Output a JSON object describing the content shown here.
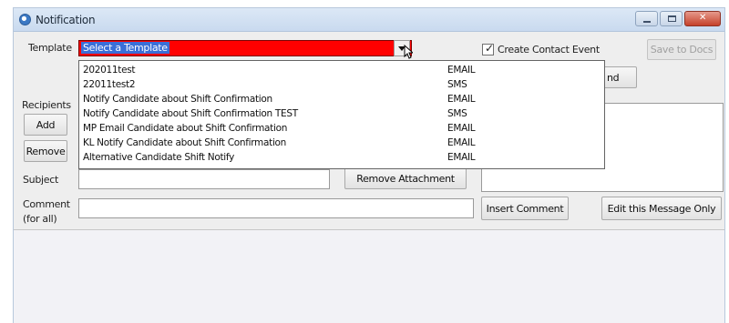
{
  "window": {
    "title": "Notification",
    "minimize_icon": "minimize-icon",
    "maximize_icon": "maximize-icon",
    "close_icon": "close-icon",
    "close_glyph": "✕"
  },
  "template": {
    "label": "Template",
    "selected": "Select a Template",
    "selected_bg": "#ff0000",
    "options": [
      {
        "name": "202011test",
        "type": "EMAIL"
      },
      {
        "name": "22011test2",
        "type": "SMS"
      },
      {
        "name": "Notify Candidate about Shift Confirmation",
        "type": "EMAIL"
      },
      {
        "name": "Notify Candidate about Shift Confirmation TEST",
        "type": "SMS"
      },
      {
        "name": "MP Email Candidate about Shift Confirmation",
        "type": "EMAIL"
      },
      {
        "name": "KL Notify Candidate about Shift Confirmation",
        "type": "EMAIL"
      },
      {
        "name": "Alternative Candidate Shift Notify",
        "type": "EMAIL"
      }
    ]
  },
  "create_contact_event": {
    "label": "Create Contact Event",
    "checked": true
  },
  "buttons": {
    "save_to_docs": "Save to Docs",
    "send_partial": "nd",
    "add": "Add",
    "remove": "Remove",
    "remove_attachment": "Remove Attachment",
    "insert_comment": "Insert Comment",
    "edit_message_only": "Edit this Message Only"
  },
  "labels": {
    "recipients": "Recipients",
    "subject": "Subject",
    "comment_line1": "Comment",
    "comment_line2": "(for all)"
  },
  "fields": {
    "subject_value": "",
    "comment_value": ""
  }
}
